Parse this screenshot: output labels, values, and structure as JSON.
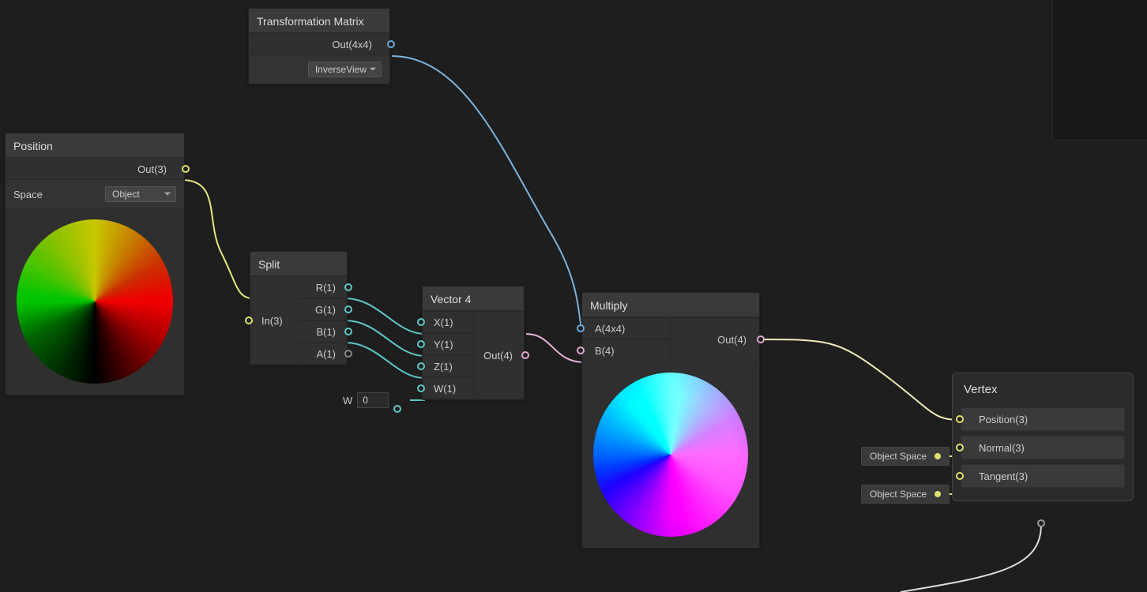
{
  "nodes": {
    "transform_matrix": {
      "title": "Transformation Matrix",
      "out_label": "Out(4x4)",
      "dropdown": "InverseView"
    },
    "position": {
      "title": "Position",
      "out_label": "Out(3)",
      "space_label": "Space",
      "space_value": "Object"
    },
    "split": {
      "title": "Split",
      "in_label": "In(3)",
      "outputs": {
        "r": "R(1)",
        "g": "G(1)",
        "b": "B(1)",
        "a": "A(1)"
      }
    },
    "vector4": {
      "title": "Vector 4",
      "out_label": "Out(4)",
      "inputs": {
        "x": "X(1)",
        "y": "Y(1)",
        "z": "Z(1)",
        "w": "W(1)"
      },
      "w_field_label": "W",
      "w_field_value": "0"
    },
    "multiply": {
      "title": "Multiply",
      "out_label": "Out(4)",
      "input_a": "A(4x4)",
      "input_b": "B(4)"
    },
    "vertex": {
      "title": "Vertex",
      "position": "Position(3)",
      "normal": "Normal(3)",
      "tangent": "Tangent(3)"
    }
  },
  "space_tags": {
    "normal": "Object Space",
    "tangent": "Object Space"
  }
}
